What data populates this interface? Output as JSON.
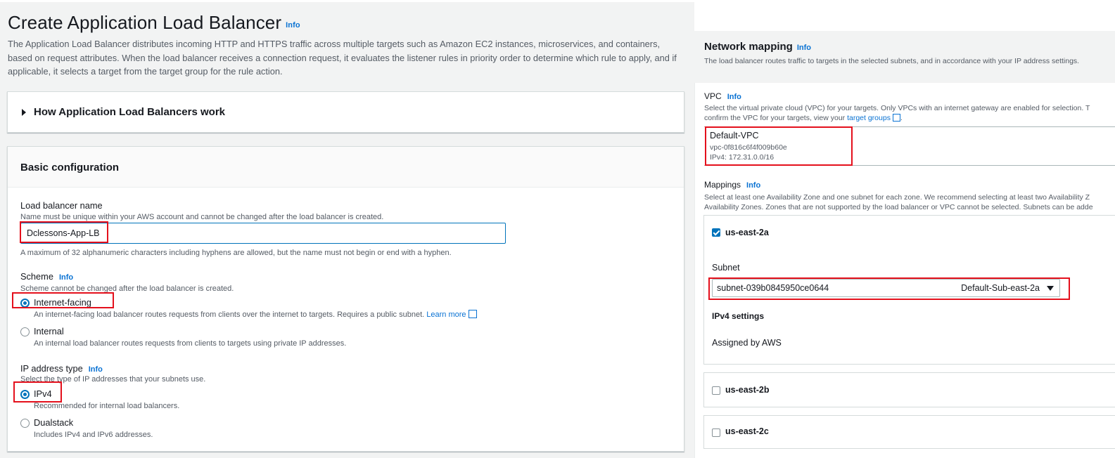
{
  "page": {
    "title": "Create Application Load Balancer",
    "title_info": "Info",
    "intro": "The Application Load Balancer distributes incoming HTTP and HTTPS traffic across multiple targets such as Amazon EC2 instances, microservices, and containers, based on request attributes. When the load balancer receives a connection request, it evaluates the listener rules in priority order to determine which rule to apply, and if applicable, it selects a target from the target group for the rule action."
  },
  "how_it_works": {
    "label": "How Application Load Balancers work"
  },
  "basic_config": {
    "title": "Basic configuration",
    "lb_name": {
      "label": "Load balancer name",
      "description": "Name must be unique within your AWS account and cannot be changed after the load balancer is created.",
      "value": "Dclessons-App-LB",
      "hint": "A maximum of 32 alphanumeric characters including hyphens are allowed, but the name must not begin or end with a hyphen."
    },
    "scheme": {
      "label": "Scheme",
      "info": "Info",
      "description": "Scheme cannot be changed after the load balancer is created.",
      "options": [
        {
          "label": "Internet-facing",
          "description": "An internet-facing load balancer routes requests from clients over the internet to targets. Requires a public subnet.",
          "link": "Learn more",
          "selected": true
        },
        {
          "label": "Internal",
          "description": "An internal load balancer routes requests from clients to targets using private IP addresses.",
          "selected": false
        }
      ]
    },
    "ip_type": {
      "label": "IP address type",
      "info": "Info",
      "description": "Select the type of IP addresses that your subnets use.",
      "options": [
        {
          "label": "IPv4",
          "description": "Recommended for internal load balancers.",
          "selected": true
        },
        {
          "label": "Dualstack",
          "description": "Includes IPv4 and IPv6 addresses.",
          "selected": false
        }
      ]
    }
  },
  "network_mapping": {
    "title": "Network mapping",
    "info": "Info",
    "description": "The load balancer routes traffic to targets in the selected subnets, and in accordance with your IP address settings.",
    "vpc": {
      "label": "VPC",
      "info": "Info",
      "desc_line1": "Select the virtual private cloud (VPC) for your targets. Only VPCs with an internet gateway are enabled for selection. T",
      "desc_line2_prefix": "confirm the VPC for your targets, view your ",
      "desc_link": "target groups",
      "name": "Default-VPC",
      "id": "vpc-0f816c6f4f009b60e",
      "cidr": "IPv4: 172.31.0.0/16"
    },
    "mappings": {
      "label": "Mappings",
      "info": "Info",
      "desc_line1": "Select at least one Availability Zone and one subnet for each zone. We recommend selecting at least two Availability Z",
      "desc_line2": "Availability Zones. Zones that are not supported by the load balancer or VPC cannot be selected. Subnets can be adde",
      "zones": [
        {
          "name": "us-east-2a",
          "checked": true
        },
        {
          "name": "us-east-2b",
          "checked": false
        },
        {
          "name": "us-east-2c",
          "checked": false
        }
      ],
      "subnet_label": "Subnet",
      "subnet_id": "subnet-039b0845950ce0644",
      "subnet_name": "Default-Sub-east-2a",
      "ipv4_settings_label": "IPv4 settings",
      "ipv4_assigned": "Assigned by AWS"
    }
  },
  "colors": {
    "accent": "#0073bb",
    "link": "#0972d3",
    "highlight": "#e4101c",
    "page_bg": "#f2f3f3"
  },
  "icons": [
    "caret-right-icon",
    "external-link-icon",
    "checkbox-icon",
    "dropdown-caret-icon"
  ]
}
